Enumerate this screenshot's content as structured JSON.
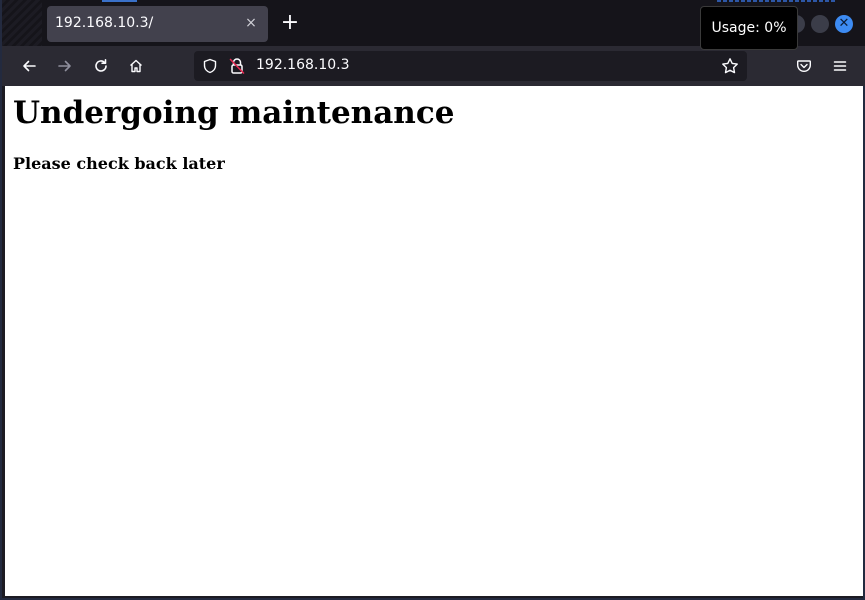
{
  "browser": {
    "tab": {
      "title": "192.168.10.3/",
      "close_glyph": "×"
    },
    "new_tab_glyph": "+",
    "usage_tooltip": "Usage: 0%",
    "window_close_glyph": "✕",
    "url": "192.168.10.3",
    "icons": {
      "back": "arrow-left-icon",
      "forward": "arrow-right-icon",
      "reload": "reload-icon",
      "home": "home-icon",
      "tracking_protection": "shield-icon",
      "connection": "insecure-lock-icon",
      "bookmark": "star-icon",
      "pocket": "pocket-icon",
      "menu": "hamburger-menu-icon"
    },
    "colors": {
      "accent": "#3d8bf2",
      "insecure_lock": "#e22850"
    }
  },
  "page": {
    "heading": "Undergoing maintenance",
    "subheading": "Please check back later"
  }
}
